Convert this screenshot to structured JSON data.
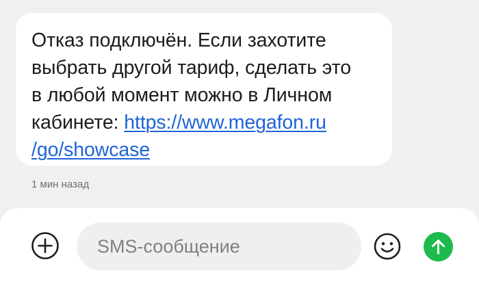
{
  "message": {
    "lines": [
      "Отказ подключён. Если захотите",
      "выбрать другой тариф, сделать это",
      "в любой момент можно в Личном",
      "кабинете: "
    ],
    "link_part1": "https://www.megafon.ru",
    "link_part2": "/go/showcase",
    "timestamp": "1 мин назад"
  },
  "composer": {
    "placeholder": "SMS-сообщение",
    "value": ""
  },
  "icons": {
    "attach": "plus-circle-icon",
    "emoji": "smiley-icon",
    "send": "arrow-up-icon"
  },
  "colors": {
    "link": "#1f63d6",
    "send_button": "#1dbb4d",
    "background": "#f0f0f0",
    "bubble": "#ffffff"
  }
}
